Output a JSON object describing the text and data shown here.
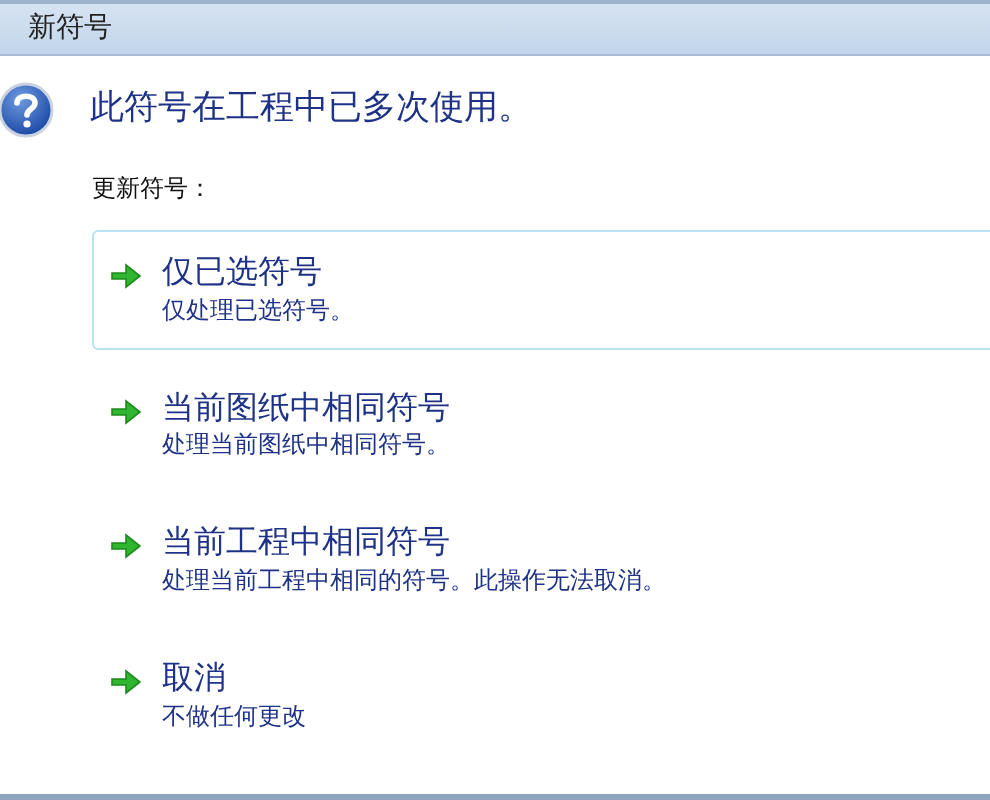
{
  "window": {
    "title": "新符号"
  },
  "heading": "此符号在工程中已多次使用。",
  "prompt": "更新符号：",
  "options": [
    {
      "title": "仅已选符号",
      "description": "仅处理已选符号。",
      "selected": true
    },
    {
      "title": "当前图纸中相同符号",
      "description": "处理当前图纸中相同符号。",
      "selected": false
    },
    {
      "title": "当前工程中相同符号",
      "description": "处理当前工程中相同的符号。此操作无法取消。",
      "selected": false
    },
    {
      "title": "取消",
      "description": "不做任何更改",
      "selected": false
    }
  ]
}
